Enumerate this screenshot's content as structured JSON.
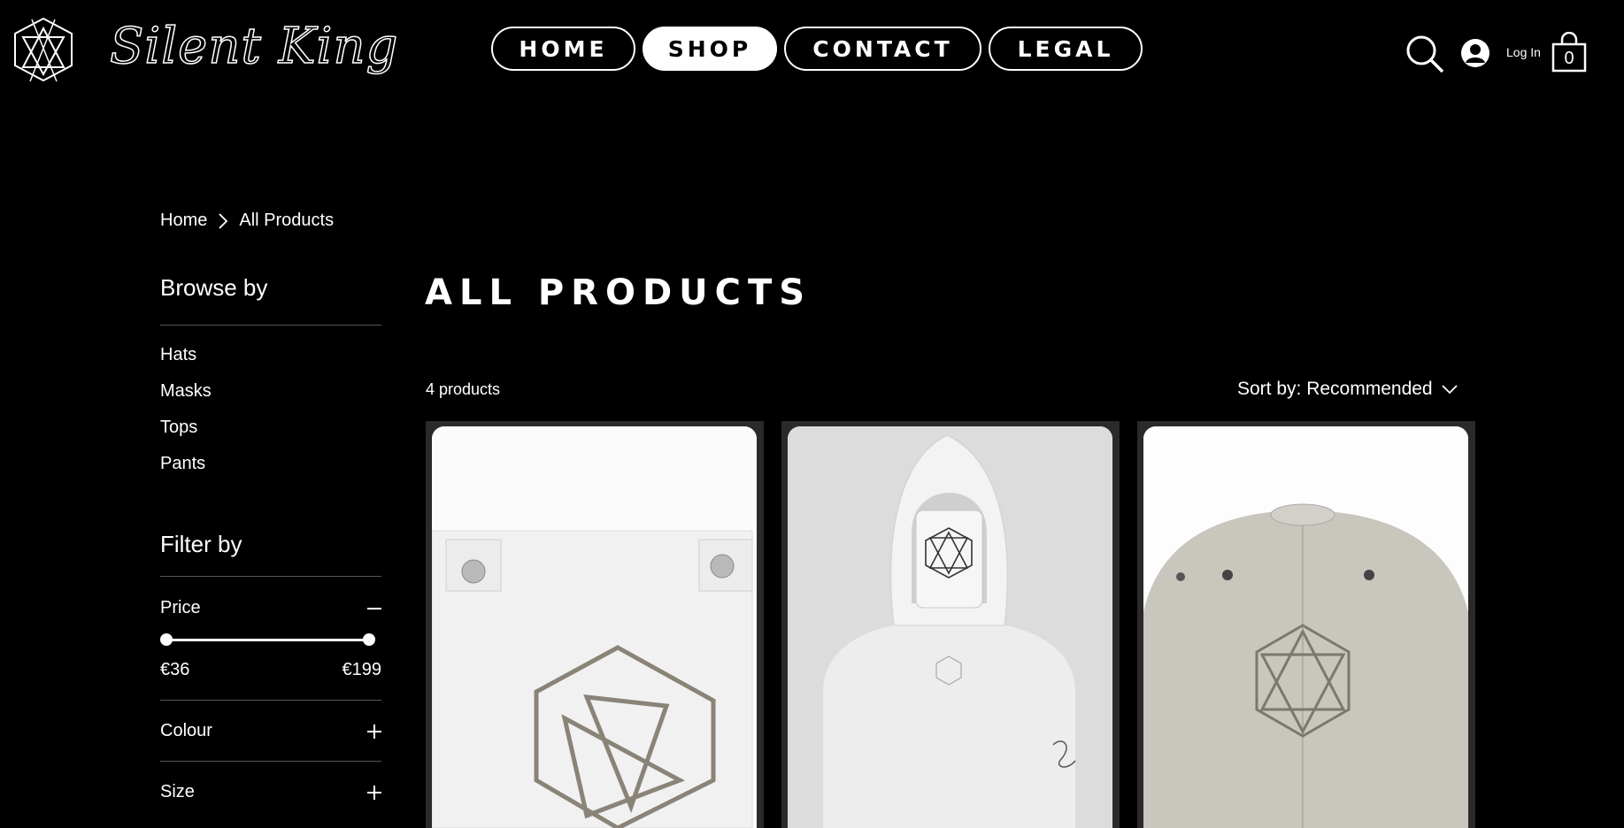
{
  "header": {
    "brand": "Silent King",
    "nav": [
      {
        "label": "HOME",
        "active": false
      },
      {
        "label": "SHOP",
        "active": true
      },
      {
        "label": "CONTACT",
        "active": false
      },
      {
        "label": "LEGAL",
        "active": false
      }
    ],
    "login_label": "Log In",
    "cart_count": "0",
    "icons": [
      "logo-mark",
      "search-icon",
      "avatar-icon",
      "cart-icon"
    ]
  },
  "breadcrumb": {
    "home": "Home",
    "current": "All Products"
  },
  "sidebar": {
    "browse_heading": "Browse by",
    "categories": [
      "Hats",
      "Masks",
      "Tops",
      "Pants"
    ],
    "filter_heading": "Filter by",
    "price": {
      "label": "Price",
      "min": "€36",
      "max": "€199"
    },
    "colour_label": "Colour",
    "size_label": "Size"
  },
  "main": {
    "title": "ALL PRODUCTS",
    "count_label": "4 products",
    "sort_label": "Sort by: Recommended"
  },
  "products": [
    {
      "image": "white mask with metallic hexagon emblem"
    },
    {
      "image": "white hoodie with face mask and emblem"
    },
    {
      "image": "beige cap with metallic hexagon emblem"
    }
  ],
  "colors": {
    "background": "#000000",
    "foreground": "#ffffff",
    "card": "#2a2a2a"
  }
}
